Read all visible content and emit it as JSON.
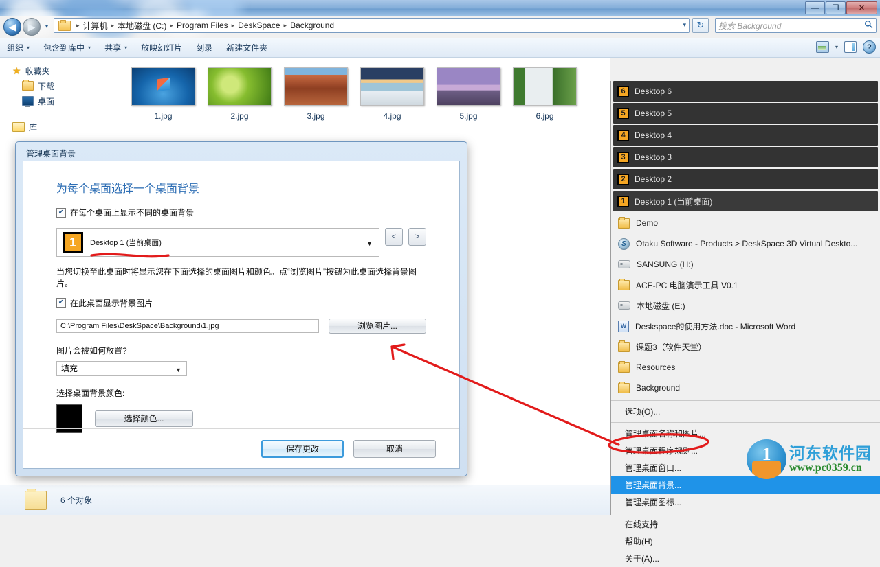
{
  "window": {
    "minimize_label": "—",
    "maximize_label": "❐",
    "close_label": "✕"
  },
  "address": {
    "back_icon": "◀",
    "forward_icon": "▶",
    "crumbs": [
      "计算机",
      "本地磁盘 (C:)",
      "Program Files",
      "DeskSpace",
      "Background"
    ],
    "separator": "▸",
    "dropdown_icon": "▾",
    "refresh_icon": "↻"
  },
  "search": {
    "placeholder": "搜索 Background",
    "icon": "🔍"
  },
  "command_bar": {
    "items": [
      {
        "label": "组织",
        "caret": "▾"
      },
      {
        "label": "包含到库中",
        "caret": "▾"
      },
      {
        "label": "共享",
        "caret": "▾"
      },
      {
        "label": "放映幻灯片",
        "caret": ""
      },
      {
        "label": "刻录",
        "caret": ""
      },
      {
        "label": "新建文件夹",
        "caret": ""
      }
    ],
    "view_caret": "▾"
  },
  "nav_pane": {
    "items": [
      {
        "label": "收藏夹",
        "icon": "star-icon",
        "level": 0
      },
      {
        "label": "下载",
        "icon": "folder-download-icon",
        "level": 1
      },
      {
        "label": "桌面",
        "icon": "desktop-monitor-icon",
        "level": 1
      },
      {
        "label": "库",
        "icon": "library-folder-icon",
        "level": 0
      }
    ]
  },
  "files": {
    "items": [
      {
        "name": "1.jpg",
        "thumb": "t1"
      },
      {
        "name": "2.jpg",
        "thumb": "t2"
      },
      {
        "name": "3.jpg",
        "thumb": "t3"
      },
      {
        "name": "4.jpg",
        "thumb": "t4"
      },
      {
        "name": "5.jpg",
        "thumb": "t5"
      },
      {
        "name": "6.jpg",
        "thumb": "t6"
      }
    ]
  },
  "status_bar": {
    "text": "6 个对象"
  },
  "deskspace_panel": {
    "desktops": [
      {
        "num": "6",
        "label": "Desktop 6",
        "current": false
      },
      {
        "num": "5",
        "label": "Desktop 5",
        "current": false
      },
      {
        "num": "4",
        "label": "Desktop 4",
        "current": false
      },
      {
        "num": "3",
        "label": "Desktop 3",
        "current": false
      },
      {
        "num": "2",
        "label": "Desktop 2",
        "current": false
      },
      {
        "num": "1",
        "label": "Desktop 1 (当前桌面)",
        "current": true
      }
    ],
    "windows": [
      {
        "label": "Demo",
        "icon": "folder-icon"
      },
      {
        "label": "Otaku Software - Products > DeskSpace 3D Virtual Deskto...",
        "icon": "web-icon"
      },
      {
        "label": "SANSUNG (H:)",
        "icon": "drive-icon"
      },
      {
        "label": "ACE-PC 电脑演示工具 V0.1",
        "icon": "folder-icon"
      },
      {
        "label": "本地磁盘 (E:)",
        "icon": "drive-icon"
      },
      {
        "label": "Deskspace的使用方法.doc - Microsoft Word",
        "icon": "word-icon"
      },
      {
        "label": "课题3（软件天堂）",
        "icon": "folder-icon"
      },
      {
        "label": "Resources",
        "icon": "folder-icon"
      },
      {
        "label": "Background",
        "icon": "folder-icon"
      }
    ],
    "options_item": "选项(O)...",
    "manage_items": [
      {
        "label": "管理桌面名称和图片...",
        "selected": false
      },
      {
        "label": "管理桌面程序规则...",
        "selected": false
      },
      {
        "label": "管理桌面窗口...",
        "selected": false
      },
      {
        "label": "管理桌面背景...",
        "selected": true
      },
      {
        "label": "管理桌面图标...",
        "selected": false
      }
    ],
    "help_items": [
      {
        "label": "在线支持"
      },
      {
        "label": "帮助(H)"
      },
      {
        "label": "关于(A)..."
      }
    ]
  },
  "watermark": {
    "title": "河东软件园",
    "url": "www.pc0359.cn",
    "logo_digit": "1"
  },
  "dialog": {
    "title": "管理桌面背景",
    "heading": "为每个桌面选择一个桌面背景",
    "checkbox_different_bg": {
      "label": "在每个桌面上显示不同的桌面背景",
      "checked": true,
      "mark": "✔"
    },
    "desktop_select": {
      "num": "1",
      "label": "Desktop 1 (当前桌面)",
      "arrow": "▼"
    },
    "prev_label": "<",
    "next_label": ">",
    "description": "当您切换至此桌面时将显示您在下面选择的桌面图片和颜色。点“浏览图片”按钮为此桌面选择背景图片。",
    "checkbox_show_bg": {
      "label": "在此桌面显示背景图片",
      "checked": true,
      "mark": "✔"
    },
    "path_value": "C:\\Program Files\\DeskSpace\\Background\\1.jpg",
    "browse_label": "浏览图片...",
    "placement_question": "图片会被如何放置?",
    "placement_value": "填充",
    "placement_arrow": "▼",
    "color_label": "选择桌面背景颜色:",
    "color_swatch": "#000000",
    "pick_color_label": "选择颜色...",
    "save_label": "保存更改",
    "cancel_label": "取消"
  },
  "colors": {
    "accent_blue": "#1f93e8",
    "desktop_badge_orange": "#f5a623",
    "panel_dark": "#333333",
    "annotation_red": "#e21b1b"
  }
}
